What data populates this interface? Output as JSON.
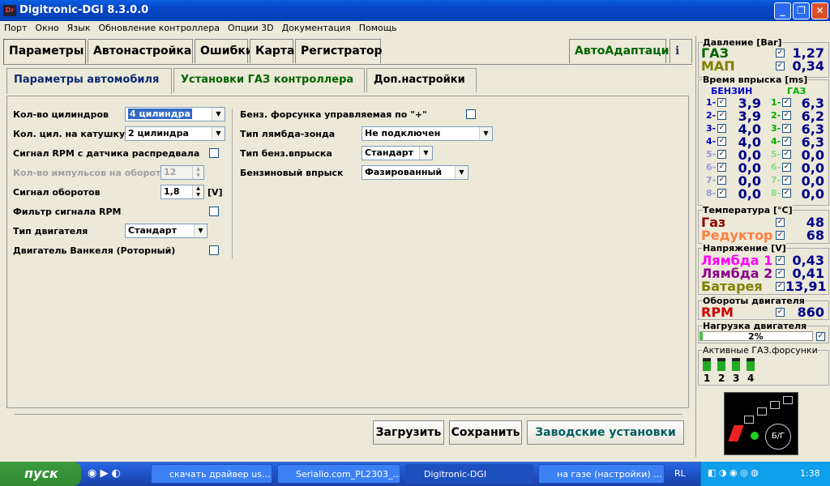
{
  "window": {
    "title": "Digitronic-DGI  8.3.0.0",
    "icon_label": "Dr"
  },
  "menu": [
    "Порт",
    "Окно",
    "Язык",
    "Обновление контроллера",
    "Опции 3D",
    "Документация",
    "Помощь"
  ],
  "main_tabs": [
    "Параметры",
    "Автонастройка",
    "Ошибки",
    "Карта",
    "Регистратор"
  ],
  "auto_adapt": "АвтоАдаптация",
  "sub_tabs": [
    "Параметры автомобиля",
    "Установки ГАЗ контроллера",
    "Доп.настройки"
  ],
  "left_form": {
    "cylinders_label": "Кол-во цилиндров",
    "cylinders_value": "4 цилиндра",
    "coil_label": "Кол. цил. на катушку",
    "coil_value": "2 цилиндра",
    "rpm_cam_label": "Сигнал RPM с датчика распредвала",
    "pulses_label": "Кол-во импульсов на оборот",
    "pulses_value": "12",
    "rpm_signal_label": "Сигнал оборотов",
    "rpm_signal_value": "1,8",
    "rpm_signal_unit": "[V]",
    "rpm_filter_label": "Фильтр сигнала RPM",
    "engine_type_label": "Тип двигателя",
    "engine_type_value": "Стандарт",
    "wankel_label": "Двигатель Ванкеля (Роторный)"
  },
  "right_form": {
    "injector_plus_label": "Бенз. форсунка управляемая по \"+\"",
    "lambda_label": "Тип лямбда-зонда",
    "lambda_value": "Не подключен",
    "inj_type_label": "Тип бенз.впрыска",
    "inj_type_value": "Стандарт",
    "petrol_inj_label": "Бензиновый впрыск",
    "petrol_inj_value": "Фазированный"
  },
  "buttons": {
    "load": "Загрузить",
    "save": "Сохранить",
    "factory": "Заводские установки"
  },
  "pressure": {
    "title": "Давление [Bar]",
    "gas_label": "ГАЗ",
    "gas_value": "1,27",
    "map_label": "МАП",
    "map_value": "0,34"
  },
  "injection": {
    "title": "Время впрыска [ms]",
    "petrol_header": "БЕНЗИН",
    "gas_header": "ГАЗ",
    "rows": [
      {
        "n": "1-",
        "petrol": "3,9",
        "gas": "6,3"
      },
      {
        "n": "2-",
        "petrol": "3,9",
        "gas": "6,2"
      },
      {
        "n": "3-",
        "petrol": "4,0",
        "gas": "6,3"
      },
      {
        "n": "4-",
        "petrol": "4,0",
        "gas": "6,3"
      },
      {
        "n": "5-",
        "petrol": "0,0",
        "gas": "0,0"
      },
      {
        "n": "6-",
        "petrol": "0,0",
        "gas": "0,0"
      },
      {
        "n": "7-",
        "petrol": "0,0",
        "gas": "0,0"
      },
      {
        "n": "8-",
        "petrol": "0,0",
        "gas": "0,0"
      }
    ]
  },
  "temperature": {
    "title": "Температура  [°C]",
    "gas_label": "Газ",
    "gas_value": "48",
    "reducer_label": "Редуктор",
    "reducer_value": "68"
  },
  "voltage": {
    "title": "Напряжение [V]",
    "lambda1_label": "Лямбда 1",
    "lambda1_value": "0,43",
    "lambda2_label": "Лямбда 2",
    "lambda2_value": "0,41",
    "battery_label": "Батарея",
    "battery_value": "13,91"
  },
  "rpm": {
    "title": "Обороты двигателя",
    "label": "RPM",
    "value": "860"
  },
  "load": {
    "title": "Нагрузка двигателя",
    "value": "2%",
    "fraction": 0.02
  },
  "active_injectors": {
    "title": "Активные ГАЗ.форсунки",
    "items": [
      "1",
      "2",
      "3",
      "4"
    ]
  },
  "switch_label": "Б/Г",
  "taskbar": {
    "start": "пуск",
    "items": [
      "скачать драйвер us...",
      "Serialio.com_PL2303_...",
      "Digitronic-DGI",
      "на газе (настройки) ..."
    ],
    "lang": "RL",
    "clock": "1:38"
  },
  "colors": {
    "gas": "#006400",
    "map": "#808000",
    "temp_gas": "#8b0000",
    "reducer": "#ff7f3f",
    "lambda1": "#ff00ff",
    "lambda2": "#8b008b",
    "battery": "#808000",
    "rpm": "#cc0000",
    "petrol_idx": "#0000cc",
    "gas_idx": "#00aa00"
  }
}
